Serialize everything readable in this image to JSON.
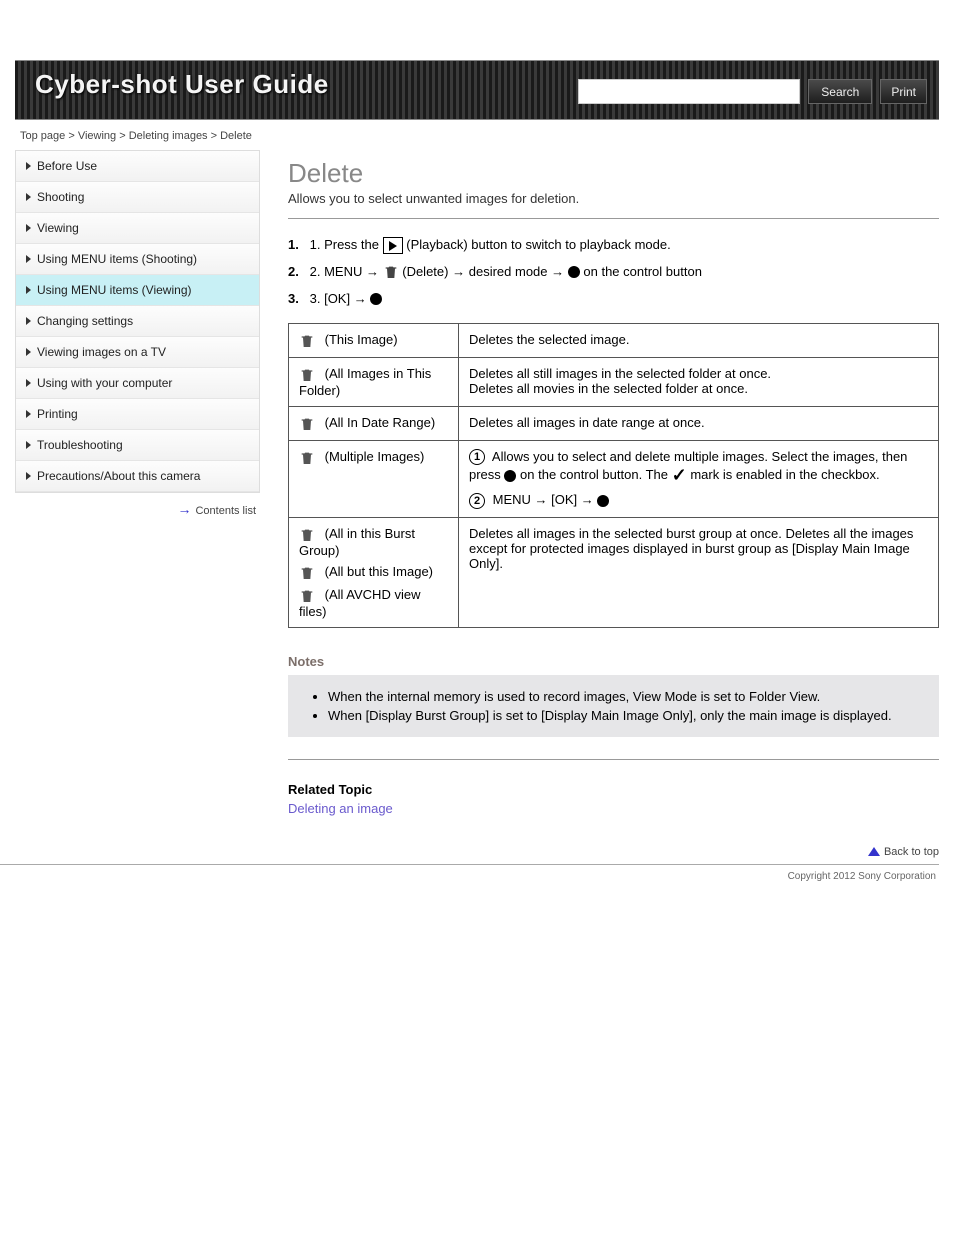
{
  "header": {
    "title": "Cyber-shot User Guide",
    "search_placeholder": "",
    "search_button": "Search",
    "print_button": "Print"
  },
  "breadcrumb": {
    "a": "Top page",
    "b": "Viewing",
    "c": "Deleting images",
    "d": "Delete"
  },
  "sidebar": {
    "items": [
      {
        "label": "Before Use"
      },
      {
        "label": "Shooting"
      },
      {
        "label": "Viewing",
        "active": false
      },
      {
        "label": "Using MENU items (Shooting)"
      },
      {
        "label": "Using MENU items (Viewing)",
        "active": true
      },
      {
        "label": "Changing settings"
      },
      {
        "label": "Viewing images on a TV"
      },
      {
        "label": "Using with your computer"
      },
      {
        "label": "Printing"
      },
      {
        "label": "Troubleshooting"
      },
      {
        "label": "Precautions/About this camera"
      }
    ],
    "collapse": "Contents list"
  },
  "page": {
    "title": "Delete",
    "subtitle": "Allows you to select unwanted images for deletion.",
    "step1": "1. Press the",
    "step1b": "(Playback) button to switch to playback mode.",
    "step2a": "2. MENU",
    "step2b": "(Delete)",
    "step2c": "desired mode",
    "step2d": "on the control button",
    "step3a": "3. [OK]",
    "table": [
      {
        "icon_name": "delete-this-image-icon",
        "label": "(This Image)",
        "desc": "Deletes the selected image."
      },
      {
        "icon_name": "delete-all-folder-icon",
        "label": "(All Images in This Folder)",
        "desc1": "Deletes all still images in the selected folder at once.",
        "desc2": "Deletes all movies in the selected folder at once."
      },
      {
        "icon_name": "delete-all-date-icon",
        "label": "(All In Date Range)",
        "desc": "Deletes all images in date range at once."
      },
      {
        "icon_name": "delete-multiple-icon",
        "label": "(Multiple Images)",
        "desc": {
          "s1a": "Allows you to select and delete multiple images. Select the images, then press",
          "s1b": "on the control button. The",
          "s1c": "mark is enabled in the checkbox.",
          "s2a": "MENU",
          "s2b": "[OK]"
        }
      },
      {
        "icon_name": "delete-all-burst-icon",
        "label": "(All in this Burst Group)",
        "desc1": "Deletes all images in the selected burst group at once. Deletes all the images except for protected images displayed in burst group as [Display Main Image Only]."
      },
      {
        "icon_name": "delete-all-but-this-icon",
        "label": "(All but this Image)"
      },
      {
        "icon_name": "delete-all-avchd-icon",
        "label": "(All AVCHD view files)"
      }
    ],
    "notes_head": "Notes",
    "notes": [
      "When the internal memory is used to record images, View Mode is set to Folder View.",
      "When [Display Burst Group] is set to [Display Main Image Only], only the main image is displayed."
    ],
    "related_head": "Related Topic",
    "related_link": "Deleting an image"
  },
  "footer": {
    "backtop": "Back to top",
    "copyright": "Copyright 2012 Sony Corporation"
  }
}
